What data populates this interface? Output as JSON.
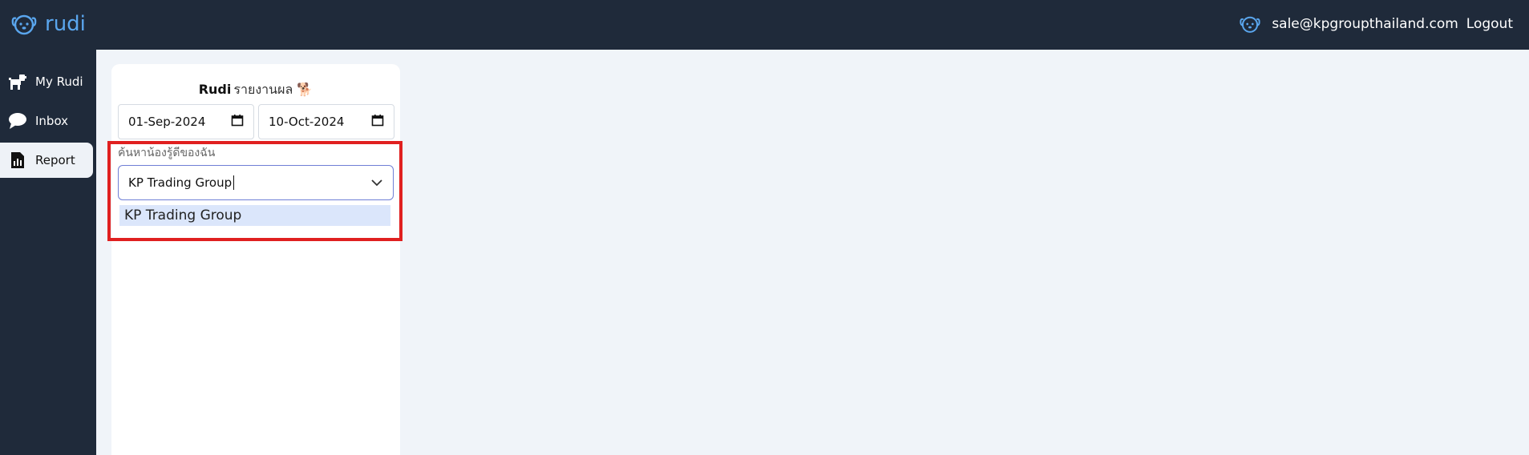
{
  "header": {
    "brand": "rudi",
    "user_email": "sale@kpgroupthailand.com",
    "logout_label": "Logout"
  },
  "sidebar": {
    "items": [
      {
        "label": "My Rudi",
        "icon": "dog-icon"
      },
      {
        "label": "Inbox",
        "icon": "chat-bubble-icon"
      },
      {
        "label": "Report",
        "icon": "report-icon",
        "active": true
      }
    ]
  },
  "report": {
    "title_bold": "Rudi",
    "title_rest": "รายงานผล",
    "title_emoji": "🐕",
    "start_date": "01-Sep-2024",
    "end_date": "10-Oct-2024",
    "search_label": "ค้นหาน้องรู้ดีของฉัน",
    "search_value": "KP Trading Group",
    "option": "KP Trading Group"
  },
  "colors": {
    "topbar": "#1f2a3a",
    "brand": "#5aa6ee",
    "highlight": "#e02020",
    "option_bg": "#dbe6fb"
  }
}
